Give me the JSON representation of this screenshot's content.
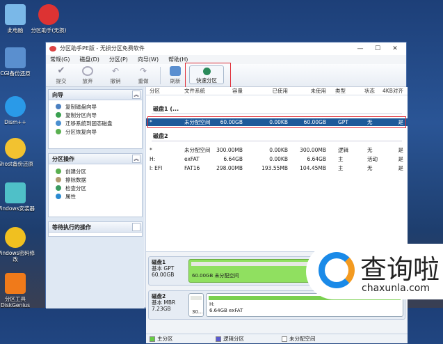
{
  "desktop": {
    "icons": [
      "此电脑",
      "分区助手(无损)",
      "CGI备份还原",
      "Dism++",
      "Ghost备份还原",
      "Windows安装器",
      "Windows密码修改",
      "分区工具DiskGenius"
    ]
  },
  "window": {
    "title": "分区助手PE版 - 无损分区免费软件",
    "controls": [
      "—",
      "☐",
      "✕"
    ]
  },
  "menu": [
    "常规(G)",
    "磁盘(D)",
    "分区(P)",
    "向导(W)",
    "帮助(H)"
  ],
  "toolbar": [
    "提交",
    "放弃",
    "撤销",
    "重做",
    "刷新",
    "快速分区"
  ],
  "wizard": {
    "title": "向导",
    "items": [
      "复制磁盘向导",
      "复制分区向导",
      "迁移系统到固态磁盘",
      "分区恢复向导"
    ]
  },
  "ops": {
    "title": "分区操作",
    "items": [
      "创建分区",
      "擦除数据",
      "检查分区",
      "属性"
    ]
  },
  "pending": {
    "title": "等待执行的操作"
  },
  "table": {
    "headers": [
      "分区",
      "文件系统",
      "容量",
      "已使用",
      "未使用",
      "类型",
      "状态",
      "4KB对齐"
    ],
    "disk1": "磁盘1 (...",
    "disk1_rows": [
      [
        "*",
        "未分配空间",
        "60.00GB",
        "0.00KB",
        "60.00GB",
        "GPT",
        "无",
        "是"
      ]
    ],
    "disk2": "磁盘2",
    "disk2_rows": [
      [
        "*",
        "未分配空间",
        "300.00MB",
        "0.00KB",
        "300.00MB",
        "逻辑",
        "无",
        "是"
      ],
      [
        "H:",
        "exFAT",
        "6.64GB",
        "0.00KB",
        "6.64GB",
        "主",
        "活动",
        "是"
      ],
      [
        "I: EFI",
        "FAT16",
        "298.00MB",
        "193.55MB",
        "104.45MB",
        "主",
        "无",
        "是"
      ]
    ]
  },
  "map": {
    "disk1": {
      "name": "磁盘1",
      "type": "基本 GPT",
      "size": "60.00GB",
      "seg": "60.00GB 未分配空间"
    },
    "disk2": {
      "name": "磁盘2",
      "type": "基本 MBR",
      "size": "7.23GB",
      "seg1": "30...",
      "seg2a": "H:",
      "seg2b": "6.64GB exFAT"
    }
  },
  "legend": [
    "主分区",
    "逻辑分区",
    "未分配空间"
  ],
  "watermark": {
    "cn": "查询啦",
    "en": "chaxunla.com"
  }
}
